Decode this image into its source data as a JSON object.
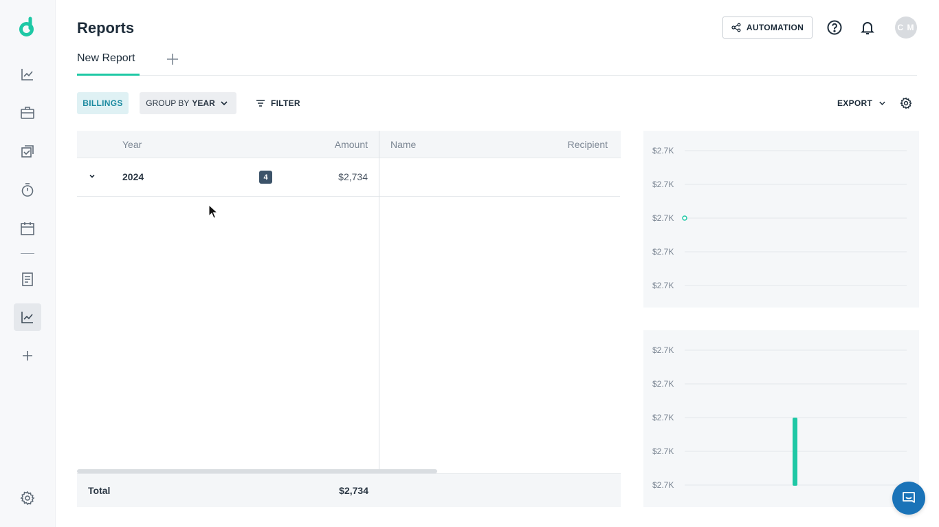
{
  "app": {
    "page_title": "Reports"
  },
  "sidebar": {
    "items": [
      {
        "name": "analytics",
        "icon": "line-chart-icon"
      },
      {
        "name": "projects",
        "icon": "briefcase-icon"
      },
      {
        "name": "tasks",
        "icon": "tasks-icon"
      },
      {
        "name": "time",
        "icon": "stopwatch-icon"
      },
      {
        "name": "calendar",
        "icon": "calendar-icon"
      },
      {
        "name": "documents",
        "icon": "document-icon"
      },
      {
        "name": "reports",
        "icon": "line-chart-icon",
        "active": true
      },
      {
        "name": "add",
        "icon": "plus-icon"
      }
    ],
    "settings_icon": "gear-icon"
  },
  "header": {
    "automation_label": "AUTOMATION",
    "help_icon": "help-icon",
    "bell_icon": "bell-icon",
    "avatar_initials": "C M"
  },
  "tabs": [
    {
      "label": "New Report",
      "active": true
    }
  ],
  "toolbar": {
    "billings_label": "BILLINGS",
    "group_by_prefix": "GROUP BY",
    "group_by_value": "YEAR",
    "filter_label": "FILTER",
    "export_label": "EXPORT"
  },
  "table": {
    "columns": [
      "Year",
      "Amount",
      "Name",
      "Recipient"
    ],
    "rows": [
      {
        "year": "2024",
        "count": "4",
        "amount": "$2,734"
      }
    ],
    "footer": {
      "label": "Total",
      "amount": "$2,734"
    }
  },
  "colors": {
    "accent": "#1ec8a5",
    "badge": "#3c5369",
    "chat": "#1a73b8"
  },
  "chart_data": [
    {
      "type": "line",
      "y_tick_labels": [
        "$2.7K",
        "$2.7K",
        "$2.7K",
        "$2.7K",
        "$2.7K"
      ],
      "series": [
        {
          "values": [
            2734
          ]
        }
      ],
      "grid": true
    },
    {
      "type": "bar",
      "y_tick_labels": [
        "$2.7K",
        "$2.7K",
        "$2.7K",
        "$2.7K",
        "$2.7K"
      ],
      "values": [
        2734
      ],
      "grid": true
    }
  ]
}
